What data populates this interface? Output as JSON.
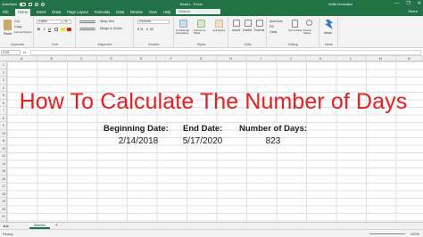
{
  "titlebar": {
    "autosave": "AutoSave",
    "doc": "Book1 - Excel",
    "user": "Sofia Gonzalez",
    "minimize": "—",
    "restore": "❐",
    "close": "✕"
  },
  "tabs": [
    "File",
    "Home",
    "Insert",
    "Draw",
    "Page Layout",
    "Formulas",
    "Data",
    "Review",
    "View",
    "Help"
  ],
  "active_tab": "Home",
  "search_placeholder": "Search",
  "share": "Share",
  "ribbon": {
    "clipboard": {
      "paste": "Paste",
      "cut": "Cut",
      "copy": "Copy",
      "format_painter": "Format Painter",
      "label": "Clipboard"
    },
    "font": {
      "name": "Calibri",
      "size": "11",
      "label": "Font",
      "bold": "B",
      "italic": "I",
      "underline": "U"
    },
    "alignment": {
      "wrap": "Wrap Text",
      "merge": "Merge & Center",
      "label": "Alignment"
    },
    "number": {
      "format": "General",
      "label": "Number"
    },
    "styles": {
      "conditional": "Conditional Formatting",
      "format_table": "Format as Table",
      "cell_styles": "Cell Styles",
      "label": "Styles"
    },
    "cells": {
      "insert": "Insert",
      "delete": "Delete",
      "format": "Format",
      "label": "Cells"
    },
    "editing": {
      "autosum": "AutoSum",
      "fill": "Fill",
      "clear": "Clear",
      "sort": "Sort & Filter",
      "find": "Find & Select",
      "label": "Editing"
    },
    "ideas": {
      "ideas": "Ideas",
      "label": "Ideas"
    }
  },
  "namebox": "C15",
  "fx": "fx",
  "columns": [
    "A",
    "B",
    "C",
    "D",
    "E",
    "F",
    "G",
    "H",
    "I",
    "J",
    "K",
    "L",
    "M",
    "N"
  ],
  "rows": [
    "1",
    "2",
    "3",
    "4",
    "5",
    "6",
    "7",
    "8",
    "9",
    "10",
    "11",
    "12",
    "13",
    "14",
    "15",
    "16",
    "17",
    "18",
    "19",
    "20",
    "21",
    "22"
  ],
  "sheet": {
    "title": "How To Calculate The Number of Days",
    "headers": {
      "begin": "Beginning Date:",
      "end": "End Date:",
      "days": "Number of Days:"
    },
    "values": {
      "begin": "2/14/2018",
      "end": "5/17/2020",
      "days": "823"
    }
  },
  "sheet_tab": "Sheet1",
  "add_sheet": "+",
  "status": {
    "ready": "Ready",
    "zoom": "100%"
  },
  "colors": {
    "excel_green": "#217346",
    "title_red": "#ee1c1c"
  }
}
